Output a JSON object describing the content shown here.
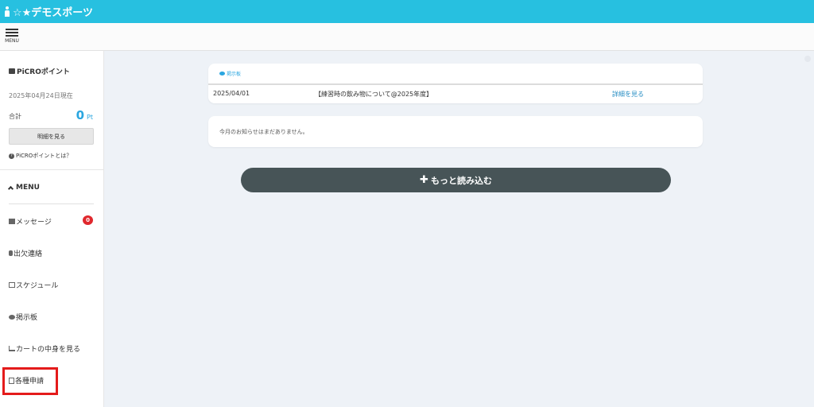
{
  "header": {
    "title": "☆★デモスポーツ",
    "menu_label": "MENU"
  },
  "points": {
    "title": "PiCROポイント",
    "date": "2025年04月24日現在",
    "total_label": "合計",
    "total_value": "0",
    "unit": "Pt",
    "detail_button": "明細を見る",
    "help_link": "PiCROポイントとは？"
  },
  "menu": {
    "heading": "MENU",
    "items": [
      {
        "label": "メッセージ",
        "icon": "envelope-icon"
      },
      {
        "label": "出欠連絡",
        "icon": "phone-icon"
      },
      {
        "label": "スケジュール",
        "icon": "calendar-icon"
      },
      {
        "label": "掲示板",
        "icon": "comment-icon"
      },
      {
        "label": "カートの中身を見る",
        "icon": "cart-icon"
      },
      {
        "label": "各種申請",
        "icon": "document-icon"
      }
    ],
    "message_badge": "0"
  },
  "board": {
    "label": "掲示板",
    "rows": [
      {
        "date": "2025/04/01",
        "title": "【練習時の飲み物について@2025年度】",
        "link": "詳細を見る"
      }
    ]
  },
  "notice": {
    "text": "今月のお知らせはまだありません。"
  },
  "load_more": {
    "label": "もっと読み込む"
  },
  "colors": {
    "topbar": "#27c0e0",
    "accent": "#2aa6e0",
    "badge": "#e0282d",
    "button_dark": "#475457",
    "highlight": "#e41b1b"
  }
}
